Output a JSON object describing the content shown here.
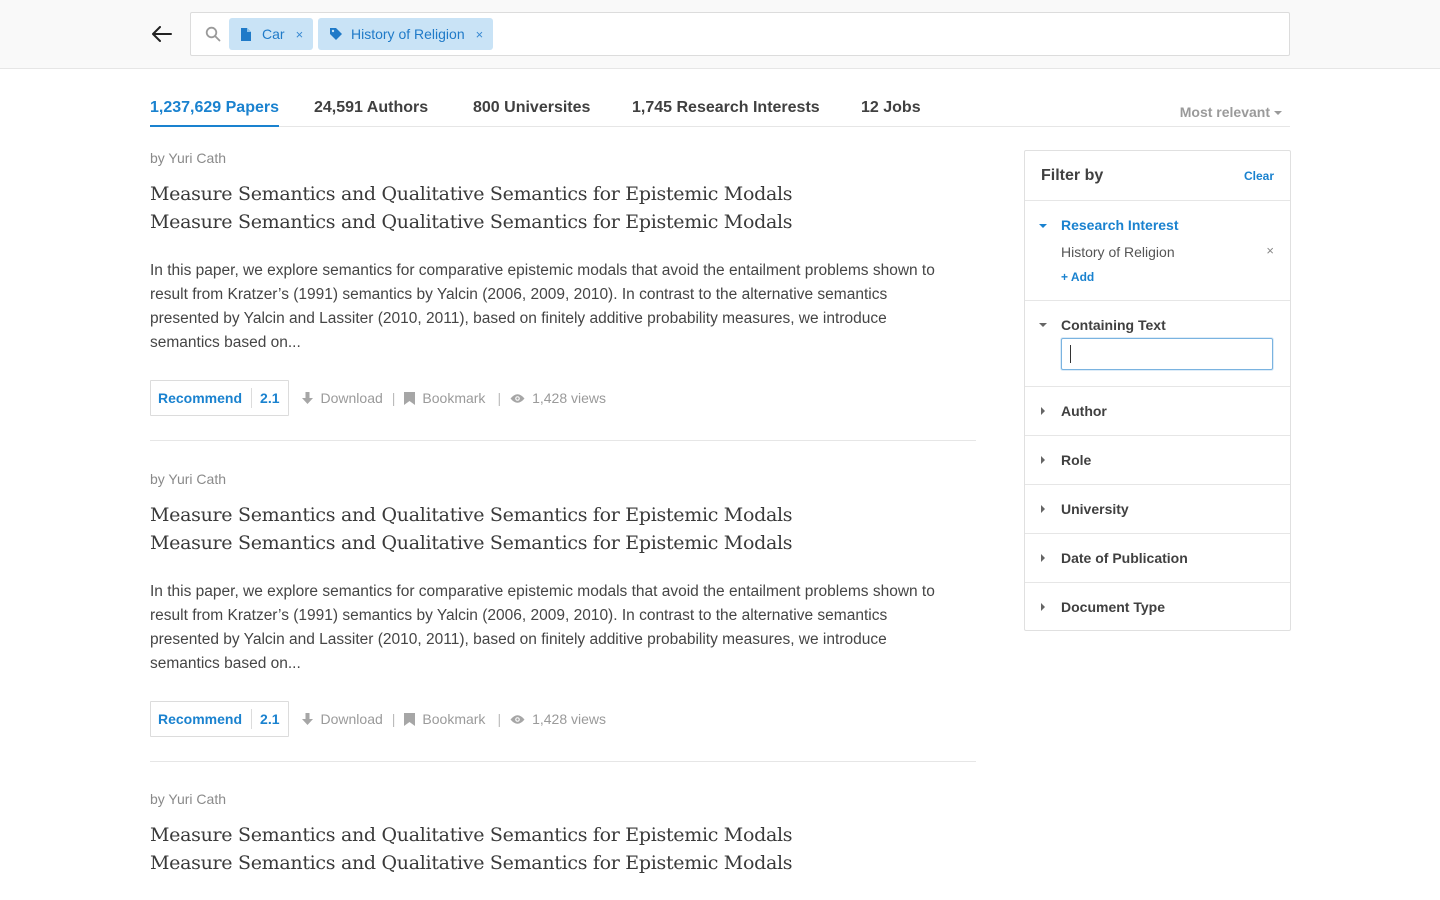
{
  "search": {
    "chips": [
      {
        "label": "Car",
        "icon": "document-icon"
      },
      {
        "label": "History of Religion",
        "icon": "tag-icon"
      }
    ],
    "close_glyph": "×"
  },
  "tabs": [
    {
      "label": "1,237,629 Papers",
      "active": true
    },
    {
      "label": "24,591 Authors",
      "active": false
    },
    {
      "label": "800 Universites",
      "active": false
    },
    {
      "label": "1,745 Research Interests",
      "active": false
    },
    {
      "label": "12 Jobs",
      "active": false
    }
  ],
  "sort": {
    "label": "Most relevant"
  },
  "results": [
    {
      "author": "by Yuri Cath",
      "title": "Measure Semantics and Qualitative Semantics for Epistemic Modals Measure Semantics and Qualitative Semantics for Epistemic Modals",
      "abstract": "In this paper, we explore semantics for comparative epistemic modals that avoid the entailment problems shown to result from Kratzer’s (1991) semantics by Yalcin (2006, 2009, 2010). In contrast to the alternative semantics presented by Yalcin and Lassiter (2010, 2011), based on finitely additive probability measures, we introduce semantics based on...",
      "recommend_label": "Recommend",
      "score": "2.1",
      "download_label": "Download",
      "bookmark_label": "Bookmark",
      "views": "1,428 views"
    },
    {
      "author": "by Yuri Cath",
      "title": "Measure Semantics and Qualitative Semantics for Epistemic Modals Measure Semantics and Qualitative Semantics for Epistemic Modals",
      "abstract": "In this paper, we explore semantics for comparative epistemic modals that avoid the entailment problems shown to result from Kratzer’s (1991) semantics by Yalcin (2006, 2009, 2010). In contrast to the alternative semantics presented by Yalcin and Lassiter (2010, 2011), based on finitely additive probability measures, we introduce semantics based on...",
      "recommend_label": "Recommend",
      "score": "2.1",
      "download_label": "Download",
      "bookmark_label": "Bookmark",
      "views": "1,428 views"
    },
    {
      "author": "by Yuri Cath",
      "title": "Measure Semantics and Qualitative Semantics for Epistemic Modals Measure Semantics and Qualitative Semantics for Epistemic Modals"
    }
  ],
  "separator": "|",
  "filter": {
    "title": "Filter by",
    "clear_label": "Clear",
    "research_interest": {
      "label": "Research Interest",
      "value": "History of Religion",
      "add_label": "+ Add"
    },
    "containing_text": {
      "label": "Containing Text",
      "value": "",
      "placeholder": ""
    },
    "sections": [
      "Author",
      "Role",
      "University",
      "Date of Publication",
      "Document Type"
    ]
  },
  "colors": {
    "accent": "#1a82cf",
    "chip_bg": "#c9e3f6",
    "topbar_bg": "#f9f9f9"
  }
}
